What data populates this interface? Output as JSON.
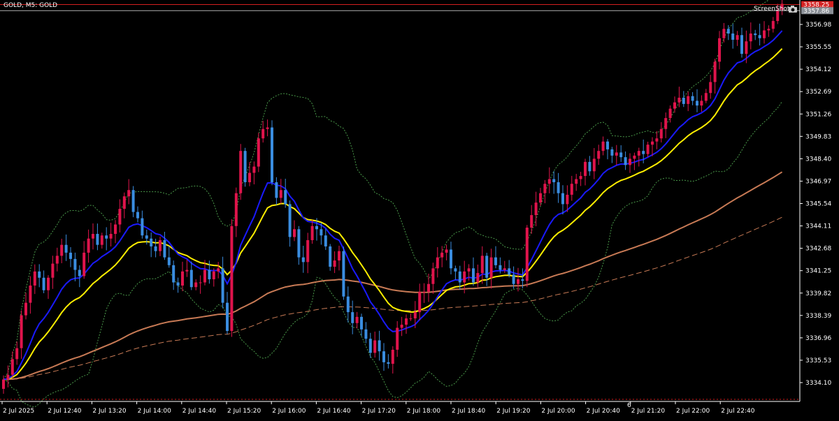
{
  "header": {
    "symbol_label": "GOLD, M5:  GOLD"
  },
  "screenshot_label": "ScreenShot",
  "marker_char": "6",
  "colors": {
    "background": "#000000",
    "bull": "#e0144c",
    "bear": "#3a8de0",
    "ma_fast": "#1a1aff",
    "ma_mid": "#ffee00",
    "ma_slow": "#c87a55",
    "bands": "#4a9a4a",
    "price_line_red": "#d42020",
    "price_line_gray": "#b0b0b0",
    "axis": "#ffffff"
  },
  "price_tags": {
    "red": "3358.25",
    "gray": "3357.86"
  },
  "chart_data": {
    "type": "candlestick",
    "y_ticks": [
      "3356.98",
      "3355.55",
      "3354.12",
      "3352.69",
      "3351.26",
      "3349.83",
      "3348.40",
      "3346.97",
      "3345.54",
      "3344.11",
      "3342.68",
      "3341.25",
      "3339.82",
      "3338.39",
      "3336.96",
      "3335.53",
      "3334.10"
    ],
    "x_ticks": [
      "2 Jul 2025",
      "2 Jul 12:40",
      "2 Jul 13:20",
      "2 Jul 14:00",
      "2 Jul 14:40",
      "2 Jul 15:20",
      "2 Jul 16:00",
      "2 Jul 16:40",
      "2 Jul 17:20",
      "2 Jul 18:00",
      "2 Jul 18:40",
      "2 Jul 19:20",
      "2 Jul 20:00",
      "2 Jul 20:40",
      "2 Jul 21:20",
      "2 Jul 22:00",
      "2 Jul 22:40"
    ],
    "closes": [
      3334.3,
      3334.6,
      3335.6,
      3336.3,
      3338.4,
      3339.2,
      3340.3,
      3341.2,
      3340.8,
      3340.0,
      3340.8,
      3341.7,
      3342.2,
      3342.9,
      3342.4,
      3342.0,
      3341.3,
      3340.9,
      3342.4,
      3343.3,
      3343.6,
      3342.9,
      3343.5,
      3343.3,
      3343.6,
      3344.2,
      3345.2,
      3346.0,
      3346.4,
      3345.0,
      3344.6,
      3343.5,
      3343.3,
      3342.8,
      3342.5,
      3343.2,
      3342.1,
      3341.6,
      3340.5,
      3340.3,
      3341.2,
      3341.3,
      3340.2,
      3340.5,
      3340.5,
      3341.3,
      3340.7,
      3341.2,
      3341.4,
      3339.2,
      3337.4,
      3344.1,
      3346.2,
      3348.9,
      3346.9,
      3347.5,
      3347.9,
      3349.7,
      3350.3,
      3350.4,
      3346.9,
      3345.9,
      3346.4,
      3345.5,
      3343.4,
      3343.9,
      3342.1,
      3341.8,
      3343.2,
      3344.1,
      3343.9,
      3343.5,
      3342.8,
      3341.5,
      3341.9,
      3342.5,
      3339.6,
      3338.6,
      3337.9,
      3338.3,
      3337.5,
      3336.9,
      3336.0,
      3336.8,
      3336.1,
      3335.4,
      3335.3,
      3336.2,
      3337.6,
      3337.8,
      3338.2,
      3338.2,
      3338.6,
      3339.9,
      3339.9,
      3340.4,
      3341.4,
      3342.1,
      3342.4,
      3342.6,
      3341.4,
      3341.2,
      3340.5,
      3341.2,
      3341.4,
      3340.5,
      3341.1,
      3342.2,
      3340.8,
      3342.1,
      3341.6,
      3341.3,
      3341.4,
      3341.0,
      3340.4,
      3340.7,
      3340.6,
      3344.0,
      3344.8,
      3345.6,
      3346.2,
      3346.8,
      3347.1,
      3346.9,
      3346.2,
      3345.5,
      3346.1,
      3346.8,
      3347.1,
      3347.3,
      3348.2,
      3347.6,
      3348.4,
      3348.9,
      3349.5,
      3349.0,
      3348.6,
      3348.8,
      3348.5,
      3348.0,
      3348.4,
      3348.6,
      3348.9,
      3348.7,
      3349.3,
      3349.5,
      3349.7,
      3350.3,
      3351.0,
      3351.6,
      3352.0,
      3352.3,
      3351.9,
      3352.4,
      3352.1,
      3351.8,
      3352.1,
      3352.6,
      3353.3,
      3354.6,
      3356.1,
      3356.7,
      3356.4,
      3356.0,
      3356.3,
      3355.1,
      3355.9,
      3356.4,
      3356.3,
      3356.1,
      3356.6,
      3356.7,
      3357.2,
      3357.9,
      3358.3
    ]
  }
}
